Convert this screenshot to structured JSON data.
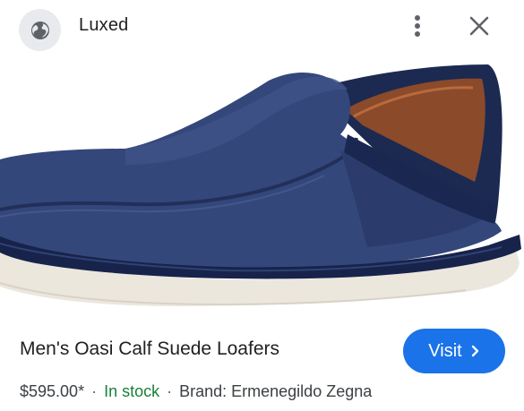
{
  "header": {
    "site_name": "Luxed",
    "site_icon": "globe-icon",
    "more_icon": "more-vert-icon",
    "close_icon": "close-icon"
  },
  "product": {
    "image": "shoe-image",
    "title": "Men's Oasi Calf Suede Loafers",
    "price": "$595.00*",
    "separator": "·",
    "stock": "In stock",
    "brand": "Brand: Ermenegildo Zegna"
  },
  "actions": {
    "visit_label": "Visit",
    "visit_icon": "chevron-right-icon"
  },
  "colors": {
    "accent": "#1a73e8",
    "stock": "#188038",
    "text": "#202124",
    "suede": "#33467a",
    "sole": "#e9e4da"
  }
}
